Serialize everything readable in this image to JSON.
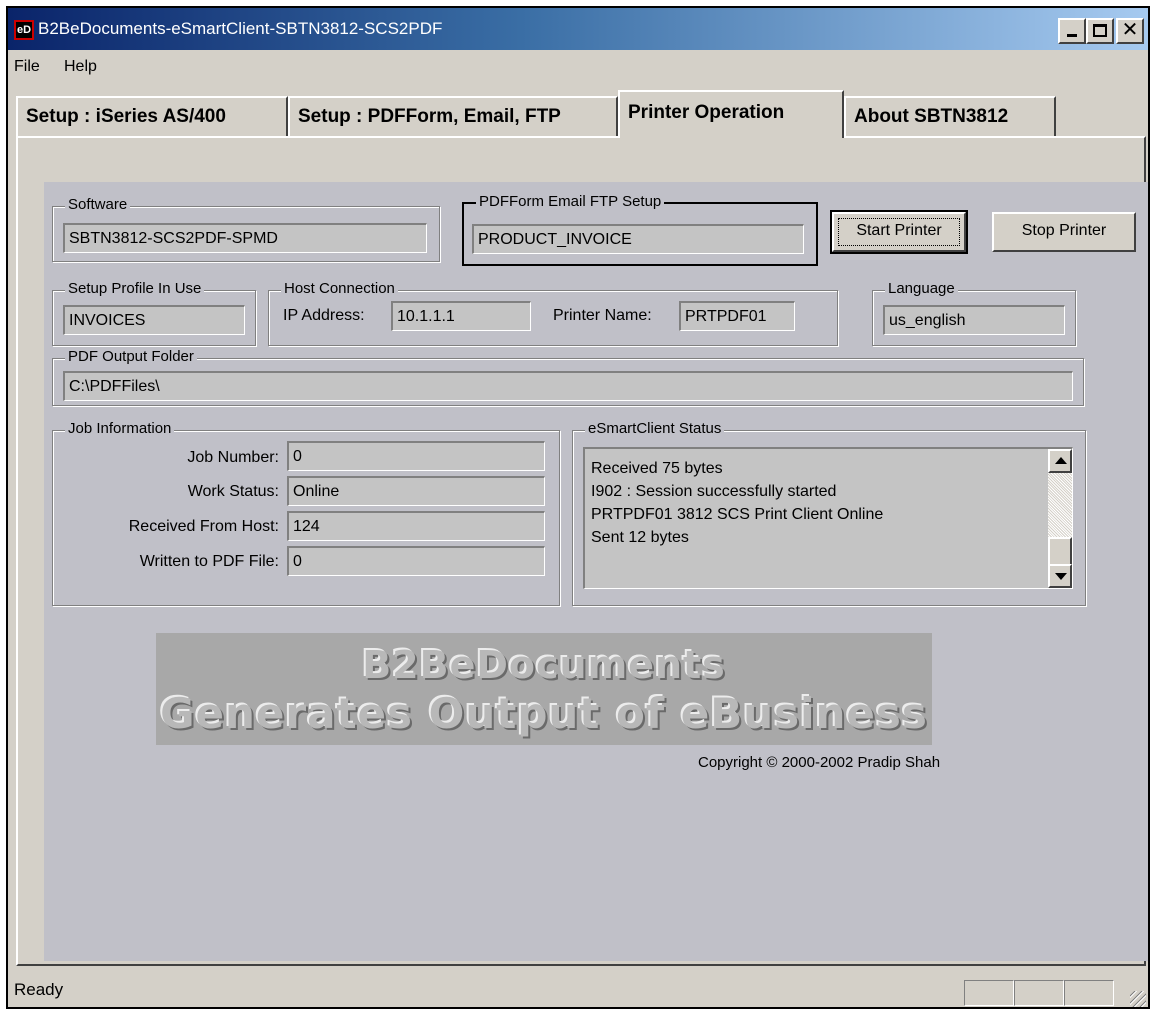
{
  "window": {
    "icon_text": "eD",
    "title": "B2BeDocuments-eSmartClient-SBTN3812-SCS2PDF"
  },
  "menu": {
    "file": "File",
    "help": "Help"
  },
  "tabs": [
    {
      "label": "Setup : iSeries AS/400"
    },
    {
      "label": "Setup : PDFForm, Email, FTP"
    },
    {
      "label": "Printer Operation"
    },
    {
      "label": "About SBTN3812"
    }
  ],
  "software": {
    "legend": "Software",
    "value": "SBTN3812-SCS2PDF-SPMD"
  },
  "pdfform": {
    "legend": "PDFForm Email FTP Setup",
    "value": "PRODUCT_INVOICE"
  },
  "buttons": {
    "start": "Start Printer",
    "stop": "Stop Printer"
  },
  "setup_profile": {
    "legend": "Setup Profile In Use",
    "value": "INVOICES"
  },
  "host": {
    "legend": "Host Connection",
    "ip_label": "IP Address:",
    "ip_value": "10.1.1.1",
    "printer_label": "Printer Name:",
    "printer_value": "PRTPDF01"
  },
  "language": {
    "legend": "Language",
    "value": "us_english"
  },
  "output_folder": {
    "legend": "PDF Output Folder",
    "value": "C:\\PDFFiles\\"
  },
  "job": {
    "legend": "Job Information",
    "job_number_label": "Job Number:",
    "job_number": "0",
    "work_status_label": "Work Status:",
    "work_status": "Online",
    "received_label": "Received From Host:",
    "received": "124",
    "written_label": "Written to PDF File:",
    "written": "0"
  },
  "client_status": {
    "legend": "eSmartClient Status",
    "lines": [
      "Received 75 bytes",
      "I902 : Session successfully started",
      "PRTPDF01 3812 SCS Print Client Online",
      "Sent 12 bytes"
    ]
  },
  "banner": {
    "line1": "B2BeDocuments",
    "line2": "Generates Output of eBusiness"
  },
  "copyright": "Copyright © 2000-2002 Pradip Shah",
  "statusbar": {
    "text": "Ready"
  }
}
